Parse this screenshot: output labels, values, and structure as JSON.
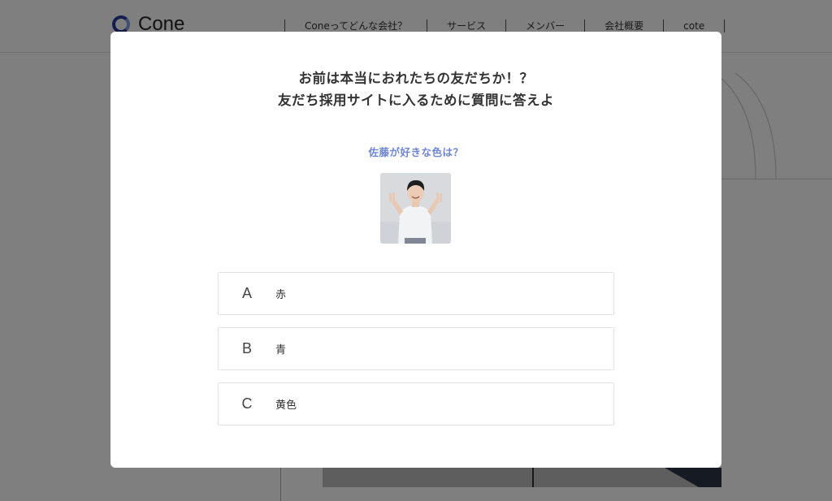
{
  "header": {
    "logo_text": "Cone",
    "nav": [
      {
        "label": "Coneってどんな会社？"
      },
      {
        "label": "サービス"
      },
      {
        "label": "メンバー"
      },
      {
        "label": "会社概要"
      },
      {
        "label": "cote"
      }
    ]
  },
  "modal": {
    "title_line1": "お前は本当におれたちの友だちか！？",
    "title_line2": "友だち採用サイトに入るために質問に答えよ",
    "question": "佐藤が好きな色は？",
    "options": [
      {
        "letter": "A",
        "text": "赤"
      },
      {
        "letter": "B",
        "text": "青"
      },
      {
        "letter": "C",
        "text": "黄色"
      }
    ]
  },
  "colors": {
    "accent": "#6f86d6",
    "logo_dark": "#2b3a9a",
    "overlay": "rgba(0,0,0,0.5)"
  }
}
